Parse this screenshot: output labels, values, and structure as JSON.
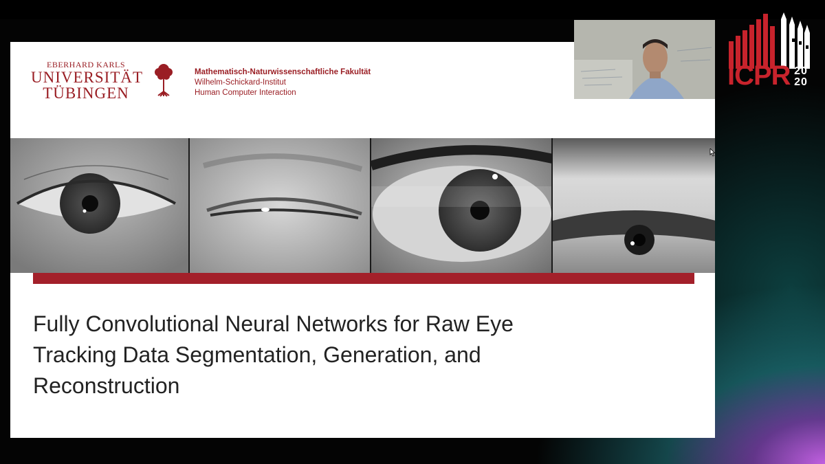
{
  "slide": {
    "university": {
      "line1": "EBERHARD KARLS",
      "line2": "UNIVERSITÄT",
      "line3": "TÜBINGEN"
    },
    "faculty": {
      "line1": "Mathematisch-Naturwissenschaftliche Fakultät",
      "line2": "Wilhelm-Schickard-Institut",
      "line3": "Human Computer Interaction"
    },
    "title_lines": [
      "Fully Convolutional Neural Networks for Raw Eye",
      "Tracking Data Segmentation, Generation, and",
      "Reconstruction"
    ],
    "eye_images": [
      "eye-image-1",
      "eye-image-2",
      "eye-image-3",
      "eye-image-4"
    ]
  },
  "conference": {
    "name": "ICPR",
    "year_top": "20",
    "year_bottom": "20",
    "brand_color": "#c8232c"
  },
  "colors": {
    "university_red": "#9a1e24",
    "bar_red": "#a3202a"
  }
}
